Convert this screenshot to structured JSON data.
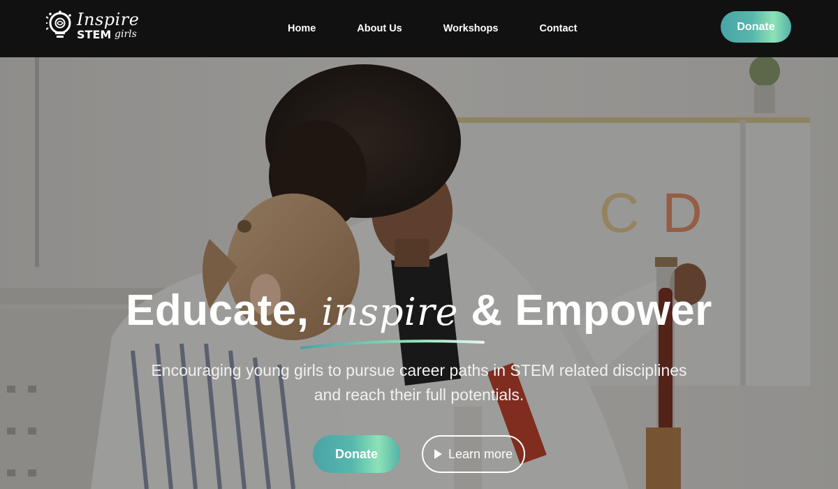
{
  "brand": {
    "line1": "Inspire",
    "line2_bold": "STEM",
    "line2_script": "girls",
    "logo_icon": "lightbulb-gear-icon"
  },
  "nav": {
    "items": [
      "Home",
      "About Us",
      "Workshops",
      "Contact"
    ]
  },
  "header": {
    "donate_label": "Donate"
  },
  "hero": {
    "title_part1": "Educate,",
    "title_script": "inspire",
    "title_part2": "& Empower",
    "subtitle": "Encouraging young girls to pursue career paths in STEM related disciplines and reach their full potentials.",
    "donate_label": "Donate",
    "learn_more_label": "Learn more",
    "learn_more_icon": "play-icon"
  },
  "colors": {
    "header_bg": "#111111",
    "accent_start": "#4aa3a6",
    "accent_highlight": "#8de2b6",
    "text": "#ffffff"
  }
}
